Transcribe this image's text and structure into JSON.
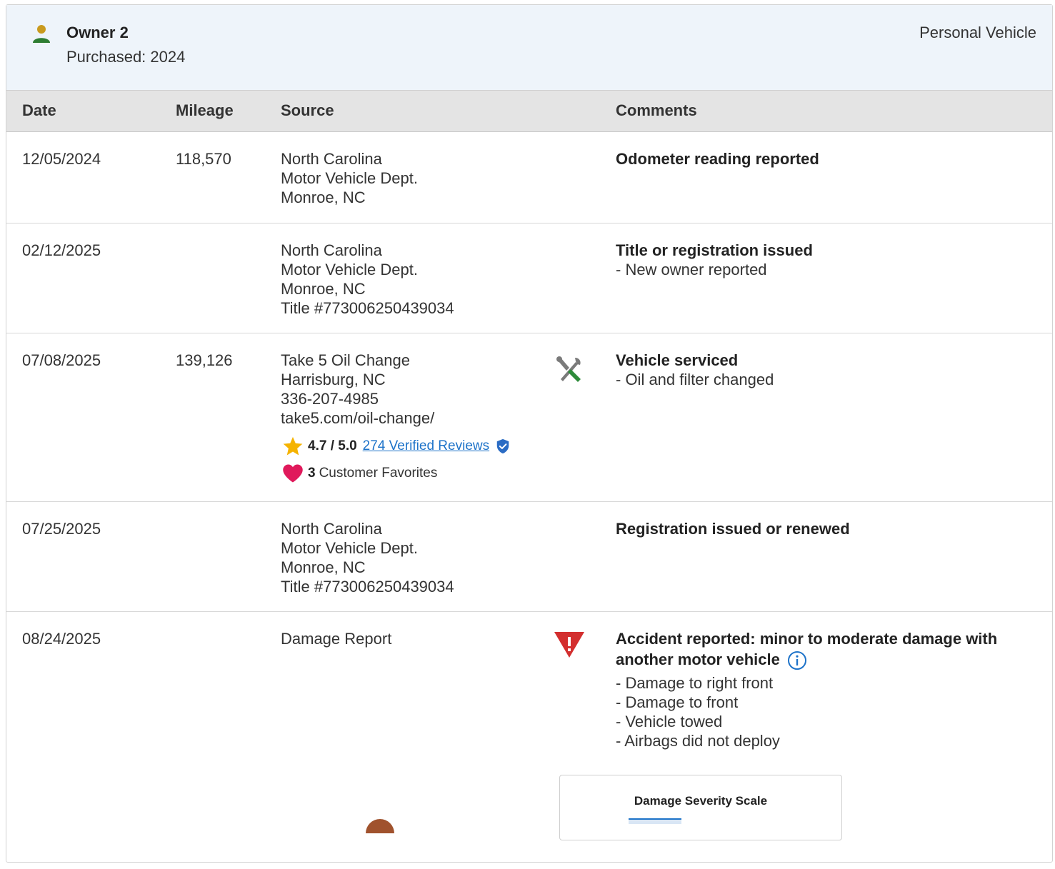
{
  "owner": {
    "name": "Owner 2",
    "purchased": "Purchased: 2024",
    "vehicle_type": "Personal Vehicle"
  },
  "table": {
    "headers": {
      "date": "Date",
      "mileage": "Mileage",
      "source": "Source",
      "comments": "Comments"
    },
    "rows": [
      {
        "date": "12/05/2024",
        "mileage": "118,570",
        "source": [
          "North Carolina",
          "Motor Vehicle Dept.",
          "Monroe, NC"
        ],
        "comment_title": "Odometer reading reported",
        "comment_details": []
      },
      {
        "date": "02/12/2025",
        "mileage": "",
        "source": [
          "North Carolina",
          "Motor Vehicle Dept.",
          "Monroe, NC",
          "Title #773006250439034"
        ],
        "comment_title": "Title or registration issued",
        "comment_details": [
          "- New owner reported"
        ]
      },
      {
        "date": "07/08/2025",
        "mileage": "139,126",
        "source": [
          "Take 5 Oil Change",
          "Harrisburg, NC",
          "336-207-4985",
          "take5.com/oil-change/"
        ],
        "icon": "wrench-screwdriver-icon",
        "rating": {
          "score": "4.7 / 5.0",
          "reviews_link": "274 Verified Reviews"
        },
        "favorites": {
          "count": "3",
          "label": "Customer Favorites"
        },
        "comment_title": "Vehicle serviced",
        "comment_details": [
          "- Oil and filter changed"
        ]
      },
      {
        "date": "07/25/2025",
        "mileage": "",
        "source": [
          "North Carolina",
          "Motor Vehicle Dept.",
          "Monroe, NC",
          "Title #773006250439034"
        ],
        "comment_title": "Registration issued or renewed",
        "comment_details": []
      },
      {
        "date": "08/24/2025",
        "mileage": "",
        "source": [
          "Damage Report"
        ],
        "icon": "warning-triangle-icon",
        "comment_title_lines": [
          "Accident reported: minor to moderate damage with",
          "another motor vehicle"
        ],
        "comment_details": [
          "- Damage to right front",
          "- Damage to front",
          "- Vehicle towed",
          "- Airbags did not deploy"
        ]
      }
    ]
  },
  "severity": {
    "title": "Damage Severity Scale"
  },
  "colors": {
    "header_bg": "#eef4fa",
    "table_header_bg": "#e4e4e4",
    "link": "#1e73c9",
    "owner_icon": "#2e7d32",
    "warning_red": "#d32f2f",
    "heart": "#e0195b",
    "star": "#f5b301"
  }
}
